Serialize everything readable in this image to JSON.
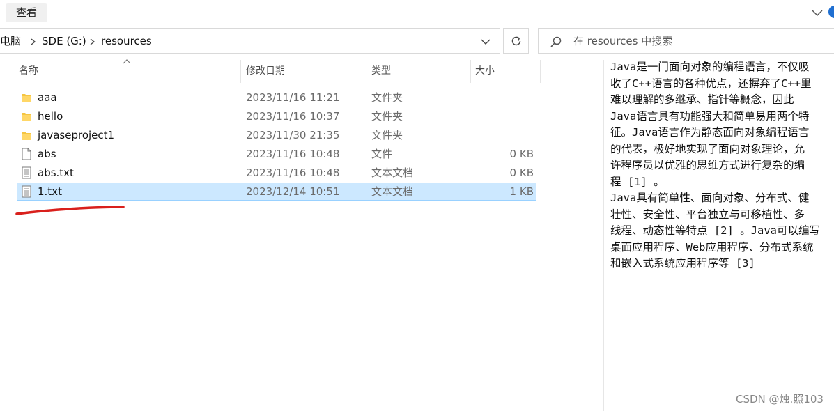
{
  "ribbon": {
    "view_tab": "查看"
  },
  "address": {
    "crumbs": [
      "此电脑",
      "SDE (G:)",
      "resources"
    ]
  },
  "search": {
    "placeholder": "在 resources 中搜索"
  },
  "columns": {
    "name": "名称",
    "date": "修改日期",
    "type": "类型",
    "size": "大小"
  },
  "files": [
    {
      "name": "aaa",
      "date": "2023/11/16 11:21",
      "type": "文件夹",
      "size": "",
      "icon": "folder-icon"
    },
    {
      "name": "hello",
      "date": "2023/11/16 10:37",
      "type": "文件夹",
      "size": "",
      "icon": "folder-icon"
    },
    {
      "name": "javaseproject1",
      "date": "2023/11/30 21:35",
      "type": "文件夹",
      "size": "",
      "icon": "folder-icon"
    },
    {
      "name": "abs",
      "date": "2023/11/16 10:48",
      "type": "文件",
      "size": "0 KB",
      "icon": "file-icon"
    },
    {
      "name": "abs.txt",
      "date": "2023/11/16 10:48",
      "type": "文本文档",
      "size": "0 KB",
      "icon": "text-file-icon"
    },
    {
      "name": "1.txt",
      "date": "2023/12/14 10:51",
      "type": "文本文档",
      "size": "1 KB",
      "icon": "text-file-icon",
      "selected": true
    }
  ],
  "preview": {
    "lines": [
      "Java是一门面向对象的编程语言，不仅吸",
      "收了C++语言的各种优点，还摒弃了C++里",
      "难以理解的多继承、指针等概念，因此",
      "Java语言具有功能强大和简单易用两个特",
      "征。Java语言作为静态面向对象编程语言",
      "的代表，极好地实现了面向对象理论，允",
      "许程序员以优雅的思维方式进行复杂的编",
      "程 [1] 。",
      "Java具有简单性、面向对象、分布式、健",
      "壮性、安全性、平台独立与可移植性、多",
      "线程、动态性等特点 [2] 。Java可以编写",
      "桌面应用程序、Web应用程序、分布式系统",
      "和嵌入式系统应用程序等 [3]"
    ]
  },
  "watermark": "CSDN @烛.照103",
  "colors": {
    "selection": "#cce8ff",
    "selection_border": "#99d1ff",
    "folder": "#f5c542",
    "annotation": "#d9201c"
  }
}
